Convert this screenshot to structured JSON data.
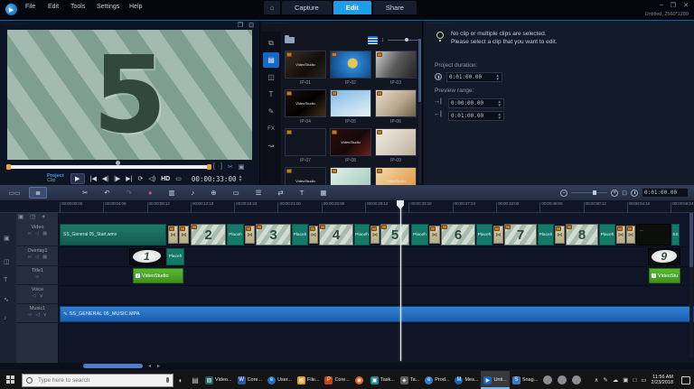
{
  "colors": {
    "accent_blue": "#1e9ee8",
    "clip_teal": "#15796a",
    "clip_green": "#4fae2c",
    "music_blue": "#1f6fc0",
    "badge_orange": "#bf7a29"
  },
  "window": {
    "menu_items": [
      "File",
      "Edit",
      "Tools",
      "Settings",
      "Help"
    ],
    "title_info": "Untitled, 2560*1280",
    "controls": {
      "min": "–",
      "restore": "❐",
      "close": "✕"
    }
  },
  "tabs": {
    "home_glyph": "⌂",
    "capture": "Capture",
    "edit": "Edit",
    "share": "Share"
  },
  "preview": {
    "countdown_number": "5",
    "project_label": "Project",
    "clip_label": "Clip",
    "controls": {
      "play": "▶",
      "home": "|◀",
      "prev": "◀|",
      "next": "|▶",
      "end": "▶|",
      "loop": "⟳",
      "volume": "◁)"
    },
    "hd_label": "HD",
    "timecode": "00:00:33:00",
    "marks": {
      "in": "[",
      "out": "]",
      "split": "✂",
      "multitrim": "▣"
    },
    "expand_glyph": "❐",
    "undock_glyph": "⊡"
  },
  "library": {
    "nav": {
      "title_glyph": "T",
      "fx_glyph": "FX"
    },
    "watermark": "VideoStudio",
    "items": [
      {
        "label": "IP-01"
      },
      {
        "label": "IP-02"
      },
      {
        "label": "IP-03"
      },
      {
        "label": "IP-04"
      },
      {
        "label": "IP-05"
      },
      {
        "label": "IP-06"
      },
      {
        "label": "IP-07"
      },
      {
        "label": "IP-08"
      },
      {
        "label": "IP-09"
      }
    ]
  },
  "info": {
    "message_line1": "No clip or multiple clips are selected.",
    "message_line2": "Please select a clip that you want to edit.",
    "project_duration_label": "Project duration:",
    "project_duration_value": "0:01:00.00",
    "preview_range_label": "Preview range:",
    "mark_in_glyph": "→|",
    "mark_out_glyph": "←|",
    "mark_in_value": "0:00:00.00",
    "mark_out_value": "0:01:00.00"
  },
  "timeline": {
    "tools": [
      {
        "name": "split",
        "glyph": "✂"
      },
      {
        "name": "undo",
        "glyph": "↶"
      },
      {
        "name": "redo",
        "glyph": "↷"
      },
      {
        "name": "record-capture",
        "glyph": "●"
      },
      {
        "name": "sound-mixer",
        "glyph": "▥"
      },
      {
        "name": "auto-music",
        "glyph": "♪"
      },
      {
        "name": "motion-tracking",
        "glyph": "⊕"
      },
      {
        "name": "subtitle-editor",
        "glyph": "▭"
      },
      {
        "name": "track-manager",
        "glyph": "☰"
      },
      {
        "name": "ripple-edit",
        "glyph": "⇄"
      },
      {
        "name": "title-3d",
        "glyph": "T"
      },
      {
        "name": "mask-creator",
        "glyph": "▦"
      }
    ],
    "duration_value": "0:01:00.00",
    "ruler_ticks": [
      "00:00:00:00",
      "00:00:04:06",
      "00:00:08:12",
      "00:00:12:18",
      "00:00:16:24",
      "00:00:21:00",
      "00:00:25:06",
      "00:00:29:12",
      "00:00:33:18",
      "00:00:37:24",
      "00:00:42:00",
      "00:00:46:06",
      "00:00:50:12",
      "00:00:54:18",
      "00:00:58:24"
    ],
    "tracks": [
      {
        "name": "Video"
      },
      {
        "name": "Overlay1"
      },
      {
        "name": "Title1"
      },
      {
        "name": "Voice"
      },
      {
        "name": "Music1"
      }
    ],
    "clips": {
      "video_start": "SS_General 05_Start.wmv",
      "numbers": [
        "2",
        "3",
        "4",
        "5",
        "6",
        "7",
        "8"
      ],
      "placeholder": "Placeh",
      "transition_glyph": "⋈",
      "overlay_left_number": "1",
      "overlay_right_number": "9",
      "title_left": "VideoStudio",
      "title_right": "VideoStu",
      "end_sliver": "SS",
      "music": "SS_GENERAL 05_MUSIC.MPA",
      "music_wave_glyph": "∿"
    }
  },
  "taskbar": {
    "search_placeholder": "Type here to search",
    "apps": [
      {
        "glyph": "▨",
        "label": "Video..."
      },
      {
        "glyph": "W",
        "label": "Core..."
      },
      {
        "glyph": "e",
        "label": "User..."
      },
      {
        "glyph": "▤",
        "label": "File..."
      },
      {
        "glyph": "P",
        "label": "Core..."
      },
      {
        "glyph": "◉",
        "label": ""
      },
      {
        "glyph": "▣",
        "label": "Task..."
      },
      {
        "glyph": "◈",
        "label": "Ta..."
      },
      {
        "glyph": "e",
        "label": "Prod..."
      },
      {
        "glyph": "M",
        "label": "Mes..."
      },
      {
        "glyph": "▶",
        "label": "Unti..."
      },
      {
        "glyph": "S",
        "label": "Snag..."
      }
    ],
    "tray_glyphs": [
      "∧",
      "✎",
      "☁",
      "▣",
      "□",
      "▭"
    ],
    "clock_time": "11:56 AM",
    "clock_date": "2/23/2018"
  }
}
